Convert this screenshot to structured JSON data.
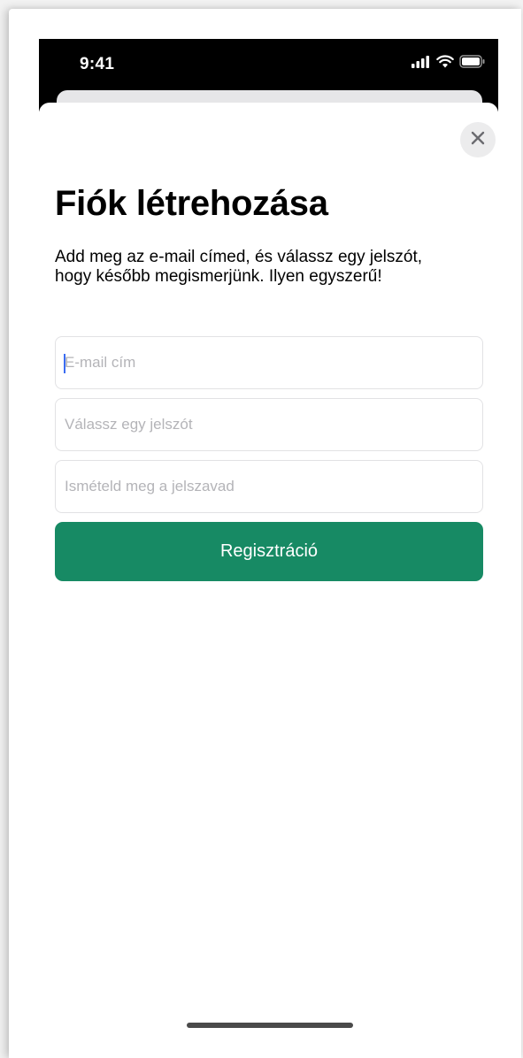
{
  "status_bar": {
    "time": "9:41",
    "icons": [
      "signal-icon",
      "wifi-icon",
      "battery-icon"
    ]
  },
  "sheet": {
    "close_icon": "close-icon",
    "title": "Fiók létrehozása",
    "subtitle": "Add meg az e-mail címed, és válassz egy jelszót, hogy később megismerjünk. Ilyen egyszerű!",
    "fields": [
      {
        "placeholder": "E-mail cím",
        "value": ""
      },
      {
        "placeholder": "Válassz egy jelszót",
        "value": ""
      },
      {
        "placeholder": "Ismételd meg a jelszavad",
        "value": ""
      }
    ],
    "register_label": "Regisztráció"
  },
  "colors": {
    "accent": "#178a64",
    "caret": "#3b6cf2",
    "status_bar_bg": "#000000"
  }
}
